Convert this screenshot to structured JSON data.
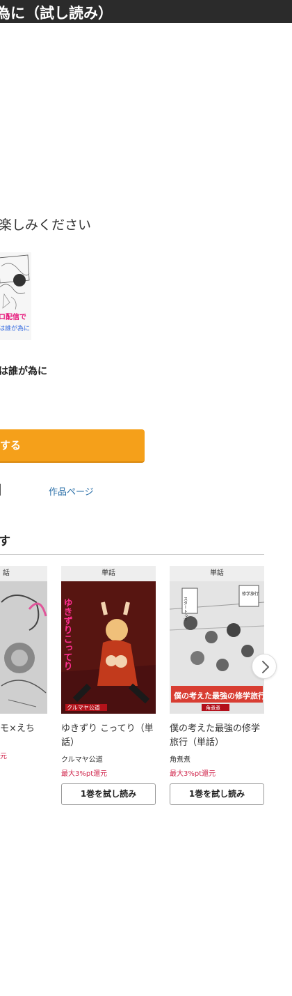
{
  "header": {
    "title": "為に（試し読み）"
  },
  "message": {
    "text": "楽しみください"
  },
  "book": {
    "thumb_text_1": "ロ配信で",
    "thumb_text_2": "は誰が為に",
    "title": "は誰が為に"
  },
  "actions": {
    "read_button": "する",
    "works_page_link": "作品ページ"
  },
  "recommend": {
    "heading": "す",
    "cards": [
      {
        "type": "話",
        "title": "モ×えち",
        "author": "",
        "points": "元",
        "trial": ""
      },
      {
        "type": "単話",
        "title": "ゆきずり こってり（単話）",
        "cover_text": "ゆきずりこってり",
        "cover_author": "クルマヤ公道",
        "author": "クルマヤ公道",
        "points": "最大3%pt還元",
        "trial": "1巻を試し読み"
      },
      {
        "type": "単話",
        "title": "僕の考えた最強の修学旅行（単話）",
        "cover_text": "僕の考えた最強の修学旅行",
        "cover_sub": "修学旅行",
        "cover_speech": "スタートっ!!",
        "cover_author": "角煮煮",
        "author": "角煮煮",
        "points": "最大3%pt還元",
        "trial": "1巻を試し読み"
      }
    ]
  },
  "colors": {
    "header_bg": "#2b2b2b",
    "accent_orange": "#f5a01a",
    "link_blue": "#2a6fa8",
    "points_red": "#d0284e"
  },
  "icons": {
    "next": "chevron-right-icon"
  }
}
